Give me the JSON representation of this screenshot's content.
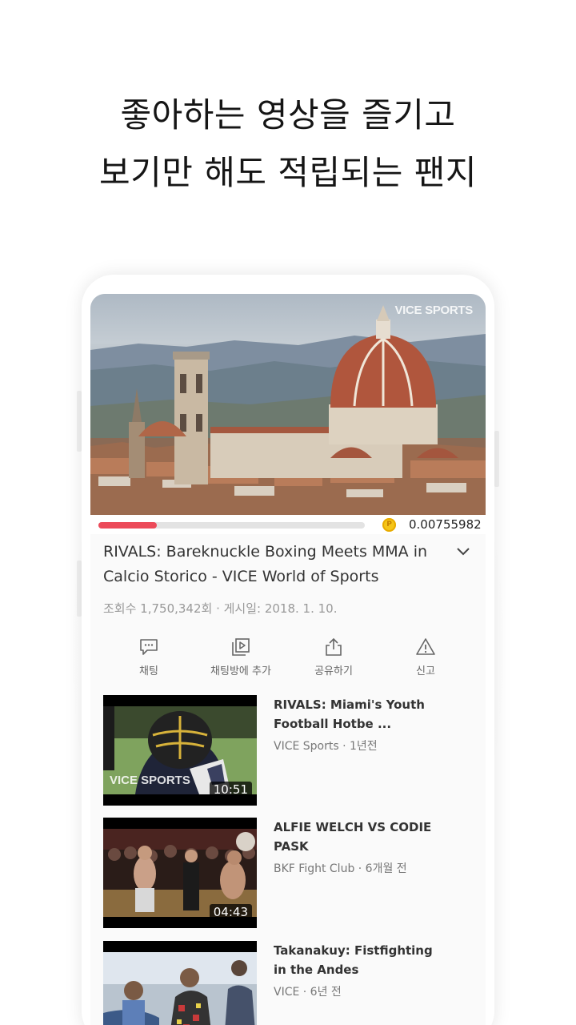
{
  "headline": {
    "line1": "좋아하는 영상을 즐기고",
    "line2": "보기만 해도 적립되는 팬지"
  },
  "player": {
    "watermark": "VICE SPORTS",
    "progress_fraction": 0.22,
    "coin_value": "0.00755982"
  },
  "video_info": {
    "title": "RIVALS: Bareknuckle Boxing Meets MMA in Calcio Storico - VICE World of Sports",
    "meta": "조회수 1,750,342회 · 게시일: 2018. 1. 10."
  },
  "actions": [
    {
      "label": "채팅",
      "icon": "chat-bubble-icon"
    },
    {
      "label": "채팅방에 추가",
      "icon": "playlist-add-icon"
    },
    {
      "label": "공유하기",
      "icon": "share-icon"
    },
    {
      "label": "신고",
      "icon": "warning-icon"
    }
  ],
  "related": [
    {
      "title": "RIVALS: Miami's Youth Football Hotbe ...",
      "sub": "VICE Sports · 1년전",
      "duration": "10:51",
      "thumb_watermark": "VICE SPORTS"
    },
    {
      "title": "ALFIE WELCH VS CODIE PASK",
      "sub": "BKF Fight Club · 6개월 전",
      "duration": "04:43"
    },
    {
      "title": "Takanakuy: Fistfighting in the Andes",
      "sub": "VICE · 6년 전",
      "duration": ""
    }
  ],
  "colors": {
    "accent": "#ec4a59",
    "coin": "#f5c518"
  }
}
